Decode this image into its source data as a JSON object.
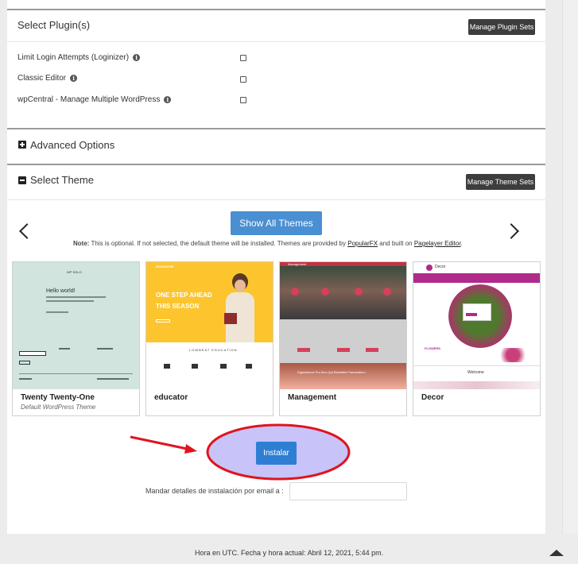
{
  "plugins": {
    "title": "Select Plugin(s)",
    "manage_label": "Manage Plugin Sets",
    "items": [
      {
        "label": "Limit Login Attempts (Loginizer)",
        "checked": false
      },
      {
        "label": "Classic Editor",
        "checked": false
      },
      {
        "label": "wpCentral - Manage Multiple WordPress",
        "checked": false
      }
    ]
  },
  "advanced": {
    "title": "Advanced Options"
  },
  "theme": {
    "title": "Select Theme",
    "manage_label": "Manage Theme Sets",
    "show_all_label": "Show All Themes",
    "note_prefix": "Note:",
    "note_text": " This is optional. If not selected, the default theme will be installed. Themes are provided by ",
    "note_link1": "PopularFX",
    "note_mid": " and built on ",
    "note_link2": "Pagelayer Editor",
    "note_end": ".",
    "cards": [
      {
        "name": "Twenty Twenty-One",
        "sub": "Default WordPress Theme"
      },
      {
        "name": "educator",
        "sub": ""
      },
      {
        "name": "Management",
        "sub": ""
      },
      {
        "name": "Decor",
        "sub": ""
      }
    ],
    "thumb_text": {
      "tt1_site": "WP SOLO",
      "tt1_heading": "Hello world!",
      "edu_headline": "ONE STEP AHEAD THIS SEASON",
      "edu_brand": "EDUCATOR",
      "edu_sub": "LOWBEAT EDUCATION",
      "mgmt_brand": "Management",
      "mgmt_banner": "Dignissimos Pro Mos Qui Blanditiis Praesentium",
      "decor_brand": "Decor",
      "decor_welcome": "Welcome",
      "decor_tag": "FLOWERS"
    }
  },
  "install": {
    "button_label": "Instalar",
    "email_label": "Mandar detalles de instalación por email a :",
    "email_value": ""
  },
  "footer": {
    "text": "Hora en UTC. Fecha y hora actual: Abril 12, 2021, 5:44 pm."
  },
  "colors": {
    "accent": "#4a8fd1",
    "annotation": "#e0141e",
    "highlight": "#c8c3f8"
  }
}
